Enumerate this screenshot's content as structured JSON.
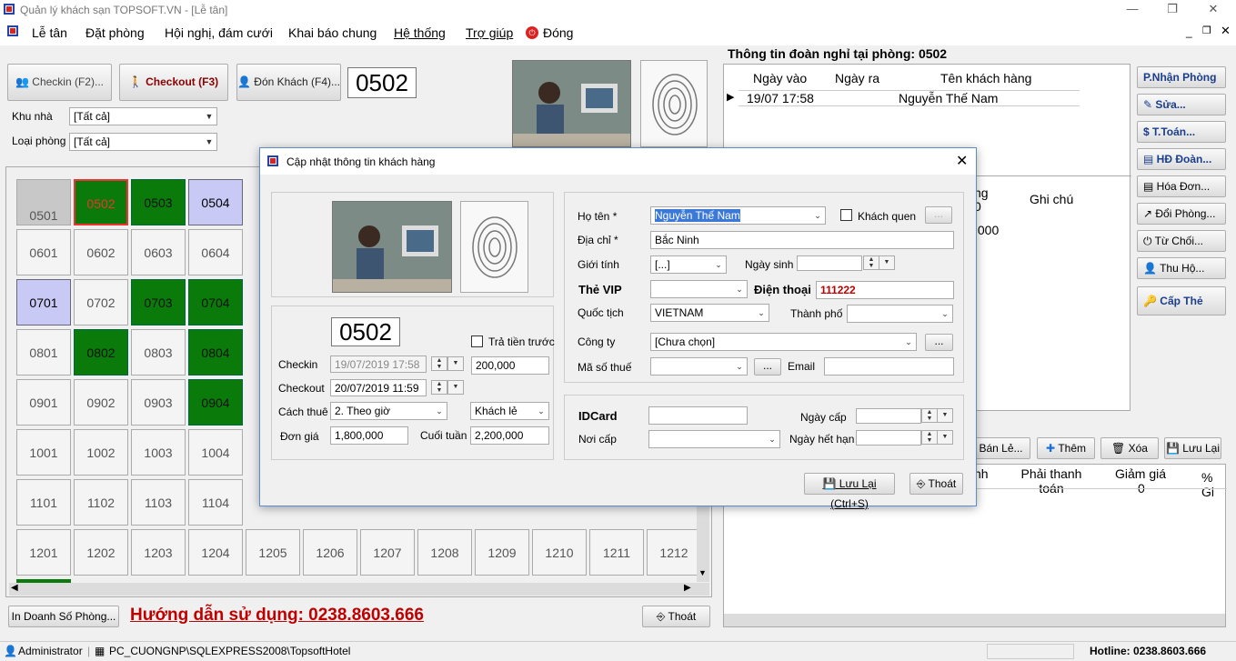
{
  "window": {
    "title": "Quản lý khách sạn TOPSOFT.VN - [Lễ tân]"
  },
  "menu": {
    "items": [
      "Lễ tân",
      "Đặt phòng",
      "Hội nghị, đám cưới",
      "Khai báo chung",
      "Hệ thống",
      "Trợ giúp"
    ],
    "close": "Đóng",
    "close_icon": "power-icon"
  },
  "toolbar": {
    "checkin": "Checkin (F2)...",
    "checkout": "Checkout (F3)",
    "don_khach": "Đón Khách (F4)...",
    "room_display": "0502"
  },
  "filters": {
    "khu_nha_label": "Khu nhà",
    "khu_nha_value": "[Tất cả]",
    "loai_phong_label": "Loại phòng",
    "loai_phong_value": "[Tất cả]"
  },
  "rooms": [
    {
      "n": "0501",
      "s": "disabled"
    },
    {
      "n": "0502",
      "s": "selected"
    },
    {
      "n": "0503",
      "s": "green"
    },
    {
      "n": "0504",
      "s": "blue"
    },
    {
      "n": "0601",
      "s": ""
    },
    {
      "n": "0602",
      "s": ""
    },
    {
      "n": "0603",
      "s": ""
    },
    {
      "n": "0604",
      "s": ""
    },
    {
      "n": "0701",
      "s": "blue"
    },
    {
      "n": "0702",
      "s": ""
    },
    {
      "n": "0703",
      "s": "green"
    },
    {
      "n": "0704",
      "s": "green"
    },
    {
      "n": "0801",
      "s": ""
    },
    {
      "n": "0802",
      "s": "green"
    },
    {
      "n": "0803",
      "s": ""
    },
    {
      "n": "0804",
      "s": "green"
    },
    {
      "n": "0901",
      "s": ""
    },
    {
      "n": "0902",
      "s": ""
    },
    {
      "n": "0903",
      "s": ""
    },
    {
      "n": "0904",
      "s": "green"
    },
    {
      "n": "1001",
      "s": ""
    },
    {
      "n": "1002",
      "s": ""
    },
    {
      "n": "1003",
      "s": ""
    },
    {
      "n": "1004",
      "s": ""
    },
    {
      "n": "1101",
      "s": ""
    },
    {
      "n": "1102",
      "s": ""
    },
    {
      "n": "1103",
      "s": ""
    },
    {
      "n": "1104",
      "s": ""
    }
  ],
  "rooms_last_row": [
    "1201",
    "1202",
    "1203",
    "1204",
    "1205",
    "1206",
    "1207",
    "1208",
    "1209",
    "1210",
    "1211",
    "1212"
  ],
  "bottom_left": {
    "in_doanh_so": "In Doanh Số Phòng...",
    "huong_dan": "Hướng dẫn sử dụng: 0238.8603.666",
    "thoat": "Thoát"
  },
  "group_info": {
    "title": "Thông tin đoàn nghỉ tại phòng: 0502",
    "headers": [
      "Ngày vào",
      "Ngày ra",
      "Tên khách hàng"
    ],
    "rows": [
      [
        "19/07 17:58",
        "",
        "Nguyễn Thế Nam"
      ]
    ]
  },
  "right_buttons": [
    "P.Nhận Phòng",
    "Sửa...",
    "T.Toán...",
    "HĐ Đoàn...",
    "Hóa Đơn...",
    "Đổi Phòng...",
    "Từ Chối...",
    "Thu Hộ...",
    "Cấp Thẻ"
  ],
  "mid_table": {
    "partial_header": "ng",
    "partial_header2": "0",
    "ghi_chu": "Ghi chú",
    "partial_value": ",000"
  },
  "service_bar": {
    "ban_le": "Bán Lẻ...",
    "them": "Thêm",
    "xoa": "Xóa",
    "luu_lai": "Lưu Lại"
  },
  "service_table": {
    "headers": [
      "nh",
      "Phải thanh toán",
      "Giảm giá",
      "% Gi"
    ],
    "giam_gia_sub": "0"
  },
  "dialog": {
    "title": "Cập nhật thông tin khách hàng",
    "room": "0502",
    "tra_tien_truoc": "Trả tiền trước",
    "checkin_label": "Checkin",
    "checkin_value": "19/07/2019 17:58",
    "prepay": "200,000",
    "checkout_label": "Checkout",
    "checkout_value": "20/07/2019 11:59",
    "cach_thue_label": "Cách thuê",
    "cach_thue_value": "2. Theo giờ",
    "loai_khach": "Khách lẻ",
    "don_gia_label": "Đơn giá",
    "don_gia_value": "1,800,000",
    "cuoi_tuan_label": "Cuối tuần",
    "cuoi_tuan_value": "2,200,000",
    "ho_ten_label": "Họ tên *",
    "ho_ten_value": "Nguyễn Thế Nam",
    "khach_quen": "Khách quen",
    "more": "...",
    "dia_chi_label": "Địa chỉ *",
    "dia_chi_value": "Bắc Ninh",
    "gioi_tinh_label": "Giới tính",
    "gioi_tinh_value": "[...]",
    "ngay_sinh_label": "Ngày sinh",
    "the_vip_label": "Thẻ VIP",
    "dien_thoai_label": "Điện thoại",
    "dien_thoai_value": "111222",
    "quoc_tich_label": "Quốc tịch",
    "quoc_tich_value": "VIETNAM",
    "thanh_pho_label": "Thành phố",
    "cong_ty_label": "Công ty",
    "cong_ty_value": "[Chưa chọn]",
    "ma_so_thue_label": "Mã số thuế",
    "email_label": "Email",
    "idcard_label": "IDCard",
    "ngay_cap_label": "Ngày cấp",
    "noi_cap_label": "Nơi cấp",
    "ngay_het_han_label": "Ngày hết hạn",
    "save": "Lưu Lại (Ctrl+S)",
    "exit": "Thoát"
  },
  "status": {
    "user": "Administrator",
    "server": "PC_CUONGNP\\SQLEXPRESS2008\\TopsoftHotel",
    "hotline": "Hotline: 0238.8603.666"
  },
  "colors": {
    "occupied": "#0a7a0a",
    "reserved": "#c9c9f5",
    "accent_red": "#c00000",
    "link_blue": "#1b3e8c"
  }
}
